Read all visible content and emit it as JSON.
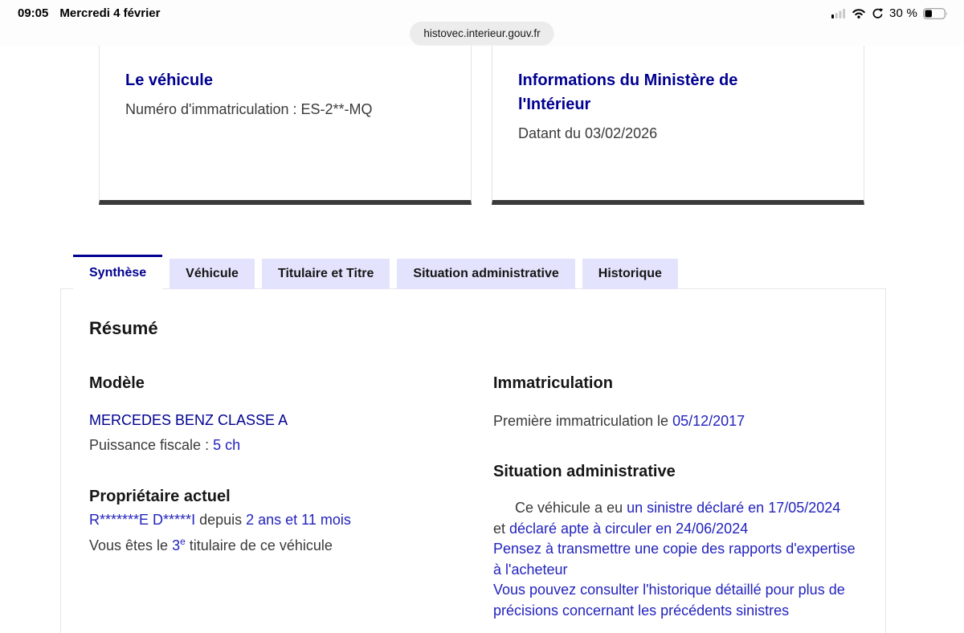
{
  "status_bar": {
    "time": "09:05",
    "date": "Mercredi 4 février",
    "battery_percent": "30 %",
    "icons": [
      "cellular-signal-icon",
      "wifi-icon",
      "rotation-lock-icon",
      "battery-icon"
    ]
  },
  "browser": {
    "url": "histovec.interieur.gouv.fr"
  },
  "cards": {
    "vehicle": {
      "title": "Le véhicule",
      "detail": "Numéro d'immatriculation : ES-2**-MQ"
    },
    "ministry": {
      "title": "Informations du Ministère de l'Intérieur",
      "detail": "Datant du 03/02/2026"
    }
  },
  "tabs": [
    {
      "label": "Synthèse",
      "active": true
    },
    {
      "label": "Véhicule",
      "active": false
    },
    {
      "label": "Titulaire et Titre",
      "active": false
    },
    {
      "label": "Situation administrative",
      "active": false
    },
    {
      "label": "Historique",
      "active": false
    }
  ],
  "summary": {
    "title": "Résumé",
    "left": {
      "model_heading": "Modèle",
      "model_name": "MERCEDES BENZ CLASSE A",
      "fiscal_segments": [
        {
          "t": "Puissance fiscale : ",
          "c": "gray"
        },
        {
          "t": "5 ch",
          "c": "blue"
        }
      ],
      "owner_heading": "Propriétaire actuel",
      "owner_segments": [
        {
          "t": "R*******E D*****I",
          "c": "blue"
        },
        {
          "t": " depuis ",
          "c": "gray"
        },
        {
          "t": "2 ans et 11 mois",
          "c": "blue"
        }
      ],
      "holder_segments": [
        {
          "t": "Vous êtes le ",
          "c": "gray"
        },
        {
          "t": "3",
          "c": "blue",
          "sup": "e"
        },
        {
          "t": " titulaire de ce véhicule",
          "c": "gray"
        }
      ]
    },
    "right": {
      "registration_heading": "Immatriculation",
      "registration_segments": [
        {
          "t": "Première immatriculation le ",
          "c": "gray"
        },
        {
          "t": "05/12/2017",
          "c": "blue"
        }
      ],
      "admin_heading": "Situation administrative",
      "admin_segments": [
        {
          "t": "Ce véhicule a eu ",
          "c": "gray"
        },
        {
          "t": "un sinistre déclaré en 17/05/2024",
          "c": "blue"
        },
        {
          "br": true,
          "t": "et ",
          "c": "gray"
        },
        {
          "t": "déclaré apte à circuler en 24/06/2024",
          "c": "blue"
        },
        {
          "br": true,
          "t": "Pensez à transmettre une copie des rapports d'expertise à l'acheteur",
          "c": "blue"
        },
        {
          "br": true,
          "t": "Vous pouvez consulter l'historique détaillé pour plus de précisions concernant les précédents sinistres",
          "c": "blue"
        }
      ]
    }
  },
  "colors": {
    "brand_blue": "#000091",
    "value_blue": "#2323be",
    "text_gray": "#3a3a3a",
    "tab_inactive_bg": "#e3e3fd",
    "card_bottom_border": "#3a3a3a"
  }
}
